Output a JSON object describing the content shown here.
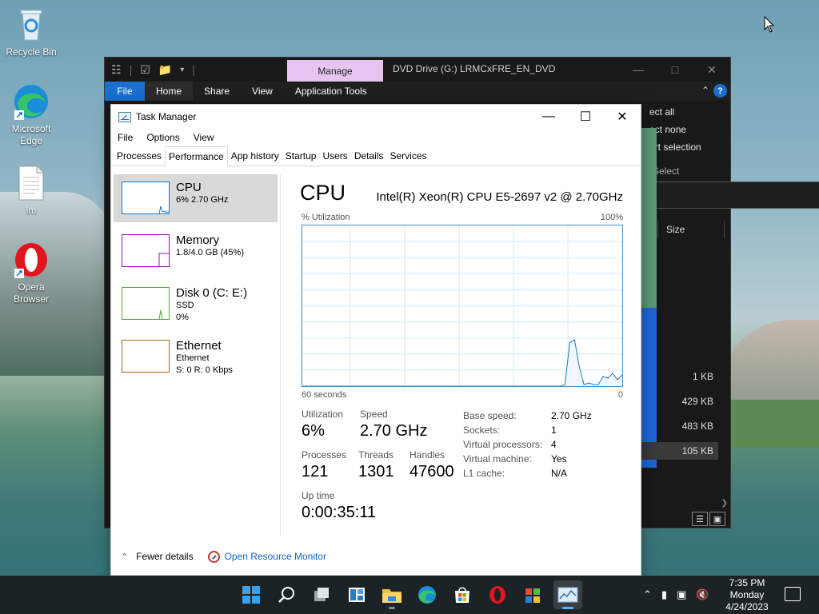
{
  "desktop": {
    "icons": [
      {
        "label": "Recycle Bin"
      },
      {
        "label": "Microsoft Edge"
      },
      {
        "label": "lm"
      },
      {
        "label": "Opera Browser"
      }
    ]
  },
  "explorer": {
    "manage_label": "Manage",
    "title": "DVD Drive (G:) LRMCxFRE_EN_DVD",
    "tabs": [
      "File",
      "Home",
      "Share",
      "View",
      "Application Tools"
    ],
    "help_label": "?",
    "select_items": [
      "ect all",
      "ect none",
      "ert selection"
    ],
    "select_group_label": "Select",
    "search_placeholder": "Q",
    "size_header": "Size",
    "sizes": [
      "1 KB",
      "429 KB",
      "483 KB",
      "105 KB"
    ]
  },
  "taskmgr": {
    "title": "Task Manager",
    "menu": [
      "File",
      "Options",
      "View"
    ],
    "tabs": [
      "Processes",
      "Performance",
      "App history",
      "Startup",
      "Users",
      "Details",
      "Services"
    ],
    "active_tab": "Performance",
    "resources": [
      {
        "name": "CPU",
        "line1": "6% 2.70 GHz",
        "line2": "",
        "line3": "",
        "color": "#1a7ac4"
      },
      {
        "name": "Memory",
        "line1": "1.8/4.0 GB (45%)",
        "line2": "",
        "line3": "",
        "color": "#8b1fa6"
      },
      {
        "name": "Disk 0 (C: E:)",
        "line1": "SSD",
        "line2": "0%",
        "line3": "",
        "color": "#4da82f"
      },
      {
        "name": "Ethernet",
        "line1": "Ethernet",
        "line2": "S: 0 R: 0 Kbps",
        "line3": "",
        "color": "#a7641b"
      }
    ],
    "cpu": {
      "heading": "CPU",
      "model": "Intel(R) Xeon(R) CPU E5-2697 v2 @ 2.70GHz",
      "util_label": "% Utilization",
      "util_max": "100%",
      "time_span": "60 seconds",
      "time_zero": "0",
      "utilization_label": "Utilization",
      "utilization": "6%",
      "speed_label": "Speed",
      "speed": "2.70 GHz",
      "processes_label": "Processes",
      "processes": "121",
      "threads_label": "Threads",
      "threads": "1301",
      "handles_label": "Handles",
      "handles": "47600",
      "uptime_label": "Up time",
      "uptime": "0:00:35:11",
      "specs": [
        {
          "k": "Base speed:",
          "v": "2.70 GHz"
        },
        {
          "k": "Sockets:",
          "v": "1"
        },
        {
          "k": "Virtual processors:",
          "v": "4"
        },
        {
          "k": "Virtual machine:",
          "v": "Yes"
        },
        {
          "k": "L1 cache:",
          "v": "N/A"
        }
      ],
      "history_percent": [
        0,
        0,
        0,
        0,
        0,
        0,
        0,
        0,
        0,
        0,
        0,
        0,
        0,
        0,
        0,
        0,
        0,
        0,
        0,
        0,
        0,
        0,
        0,
        0,
        0,
        0,
        0,
        0,
        0,
        0,
        0,
        0,
        0,
        0,
        0,
        0,
        0,
        0,
        0,
        0,
        0,
        0,
        0,
        0,
        0,
        0,
        0,
        0,
        0,
        0,
        0,
        0,
        0,
        0,
        0,
        1,
        27,
        29,
        12,
        1,
        2,
        1,
        1,
        6,
        5,
        8,
        4,
        7
      ]
    },
    "footer": {
      "fewer_details": "Fewer details",
      "open_monitor": "Open Resource Monitor"
    }
  },
  "taskbar": {
    "time": "7:35 PM",
    "day": "Monday",
    "date": "4/24/2023",
    "apps": [
      "start-icon",
      "search-icon",
      "task-view-icon",
      "widgets-icon",
      "file-explorer-icon",
      "edge-icon",
      "store-icon",
      "opera-icon",
      "winrar-icon",
      "task-manager-icon"
    ]
  }
}
